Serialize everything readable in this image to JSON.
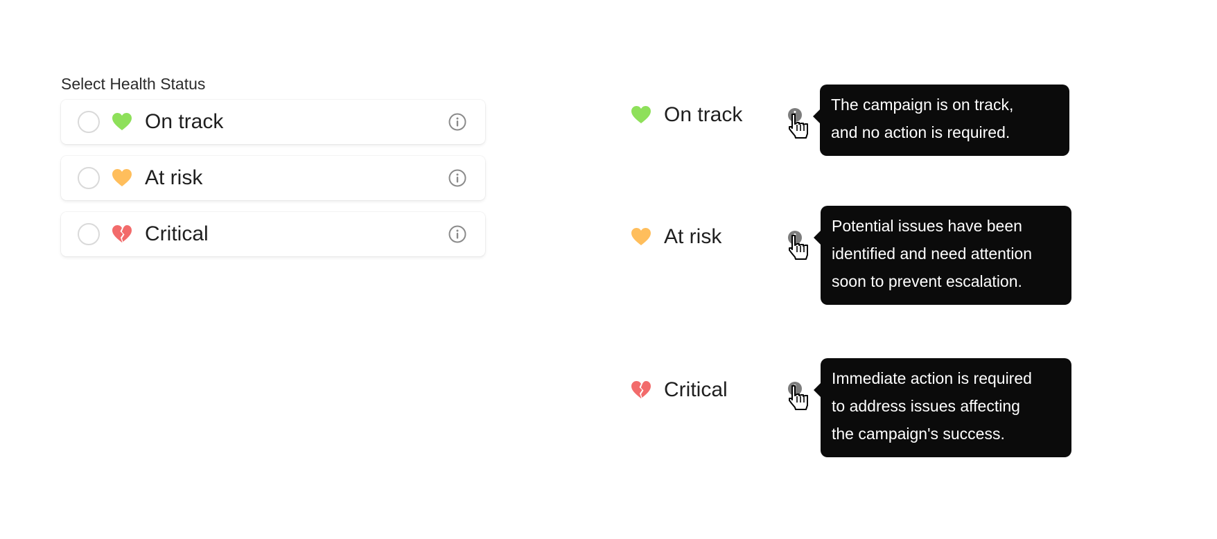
{
  "panel": {
    "title": "Select Health Status",
    "options": [
      {
        "label": "On track",
        "icon": "heart-icon",
        "color": "#8ee05a",
        "info_icon": "info-icon"
      },
      {
        "label": "At risk",
        "icon": "heart-icon",
        "color": "#ffbe5c",
        "info_icon": "info-icon"
      },
      {
        "label": "Critical",
        "icon": "broken-heart-icon",
        "color": "#f26b6b",
        "info_icon": "info-icon"
      }
    ]
  },
  "showcase": [
    {
      "label": "On track",
      "tooltip": [
        "The campaign is on track,",
        "and no action is required."
      ]
    },
    {
      "label": "At risk",
      "tooltip": [
        "Potential issues have been",
        "identified and need attention",
        "soon to prevent escalation."
      ]
    },
    {
      "label": "Critical",
      "tooltip": [
        "Immediate action is required",
        "to address issues affecting",
        "the campaign's success."
      ]
    }
  ],
  "colors": {
    "tooltip_bg": "#0b0b0b",
    "radio_border": "#d9d9d9",
    "info_gray": "#8a8a8a"
  }
}
